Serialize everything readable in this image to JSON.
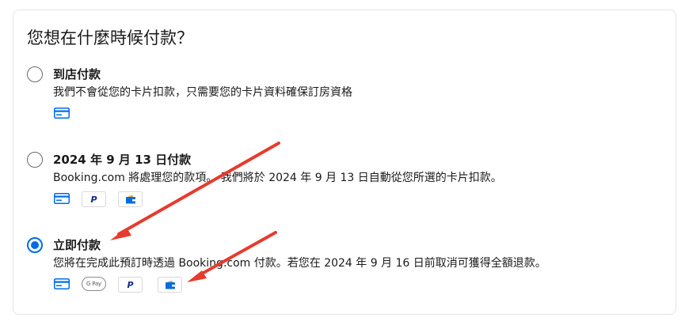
{
  "section": {
    "title": "您想在什麼時候付款？"
  },
  "options": [
    {
      "label": "到店付款",
      "description": "我們不會從您的卡片扣款，只需要您的卡片資料確保訂房資格",
      "selected": false,
      "payment_icons": [
        "credit-card-icon"
      ]
    },
    {
      "label": "2024 年 9 月 13 日付款",
      "description": "Booking.com 將處理您的款項。 我們將於 2024 年 9 月 13 日自動從您所選的卡片扣款。",
      "selected": false,
      "payment_icons": [
        "credit-card-icon",
        "paypal-icon",
        "wallet-icon"
      ]
    },
    {
      "label": "立即付款",
      "description": "您將在完成此預訂時透過 Booking.com 付款。若您在 2024 年 9 月 16 日前取消可獲得全額退款。",
      "selected": true,
      "payment_icons": [
        "credit-card-icon",
        "google-pay-icon",
        "paypal-icon",
        "wallet-icon"
      ]
    }
  ],
  "icon_text": {
    "gpay": "G Pay",
    "paypal": "P"
  },
  "colors": {
    "accent": "#006ce4",
    "annotation_arrow": "#e63b2e",
    "paypal": "#0b2f87"
  }
}
